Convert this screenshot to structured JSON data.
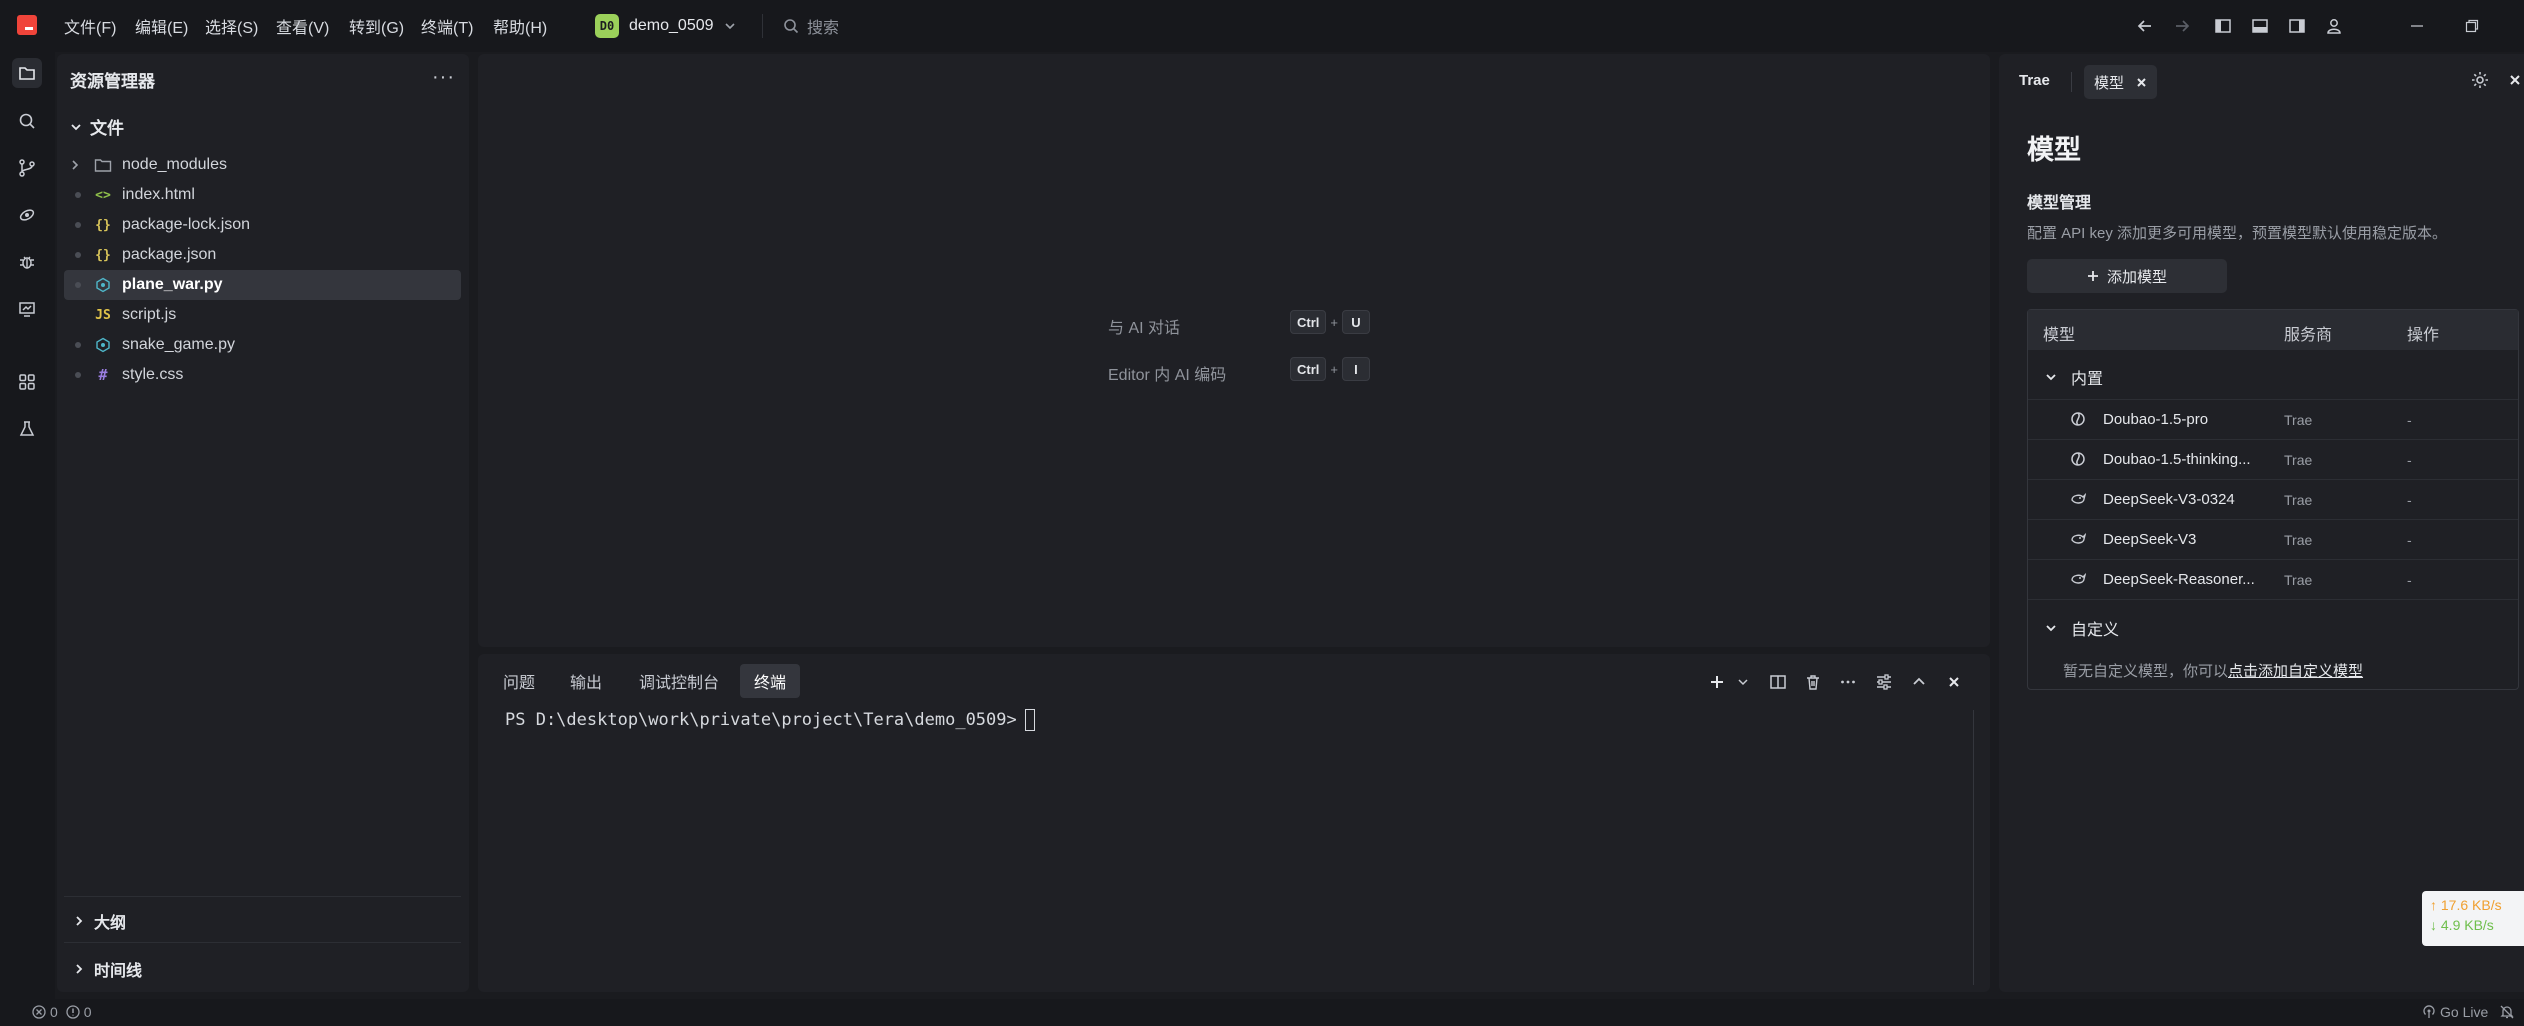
{
  "menu": [
    "文件(F)",
    "编辑(E)",
    "选择(S)",
    "查看(V)",
    "转到(G)",
    "终端(T)",
    "帮助(H)"
  ],
  "project": {
    "badge": "D0",
    "name": "demo_0509"
  },
  "search": {
    "placeholder": "搜索"
  },
  "explorer": {
    "title": "资源管理器",
    "more": "···",
    "section": "文件",
    "files": [
      {
        "name": "node_modules",
        "type": "folder",
        "icon": "folder-icon"
      },
      {
        "name": "index.html",
        "type": "html",
        "icon": "html-file-icon",
        "glyph": "<>"
      },
      {
        "name": "package-lock.json",
        "type": "json",
        "icon": "json-file-icon",
        "glyph": "{}"
      },
      {
        "name": "package.json",
        "type": "json",
        "icon": "json-file-icon",
        "glyph": "{}"
      },
      {
        "name": "plane_war.py",
        "type": "python",
        "icon": "python-file-icon",
        "selected": true
      },
      {
        "name": "script.js",
        "type": "js",
        "icon": "js-file-icon",
        "glyph": "JS"
      },
      {
        "name": "snake_game.py",
        "type": "python",
        "icon": "python-file-icon"
      },
      {
        "name": "style.css",
        "type": "css",
        "icon": "css-file-icon",
        "glyph": "#"
      }
    ],
    "outline": "大纲",
    "timeline": "时间线"
  },
  "editor": {
    "hints": [
      {
        "label": "与 AI 对话",
        "keys": [
          "Ctrl",
          "U"
        ]
      },
      {
        "label": "Editor 内 AI 编码",
        "keys": [
          "Ctrl",
          "I"
        ]
      }
    ],
    "plus": "+"
  },
  "terminal": {
    "tabs": [
      "问题",
      "输出",
      "调试控制台",
      "终端"
    ],
    "active_tab": "终端",
    "prompt": "PS D:\\desktop\\work\\private\\project\\Tera\\demo_0509>"
  },
  "right_panel": {
    "tab_trae": "Trae",
    "tab_model": "模型",
    "title": "模型",
    "subtitle": "模型管理",
    "description": "配置 API key 添加更多可用模型，预置模型默认使用稳定版本。",
    "add_button": "添加模型",
    "table": {
      "headers": [
        "模型",
        "服务商",
        "操作"
      ],
      "builtin_group": "内置",
      "models": [
        {
          "name": "Doubao-1.5-pro",
          "provider": "Trae",
          "op": "-",
          "icon": "doubao-icon"
        },
        {
          "name": "Doubao-1.5-thinking...",
          "provider": "Trae",
          "op": "-",
          "icon": "doubao-icon"
        },
        {
          "name": "DeepSeek-V3-0324",
          "provider": "Trae",
          "op": "-",
          "icon": "deepseek-icon"
        },
        {
          "name": "DeepSeek-V3",
          "provider": "Trae",
          "op": "-",
          "icon": "deepseek-icon"
        },
        {
          "name": "DeepSeek-Reasoner...",
          "provider": "Trae",
          "op": "-",
          "icon": "deepseek-icon"
        }
      ],
      "custom_group": "自定义",
      "custom_empty_text": "暂无自定义模型，你可以",
      "custom_empty_link": "点击添加自定义模型"
    }
  },
  "network": {
    "up": "↑ 17.6 KB/s",
    "down": "↓ 4.9 KB/s"
  },
  "statusbar": {
    "errors": "0",
    "warnings": "0",
    "go_live": "Go Live"
  },
  "colors": {
    "accent_logo": "#f0443a",
    "project_badge": "#9bd05a",
    "net_up": "#f0a030",
    "net_down": "#6fbf4c"
  }
}
